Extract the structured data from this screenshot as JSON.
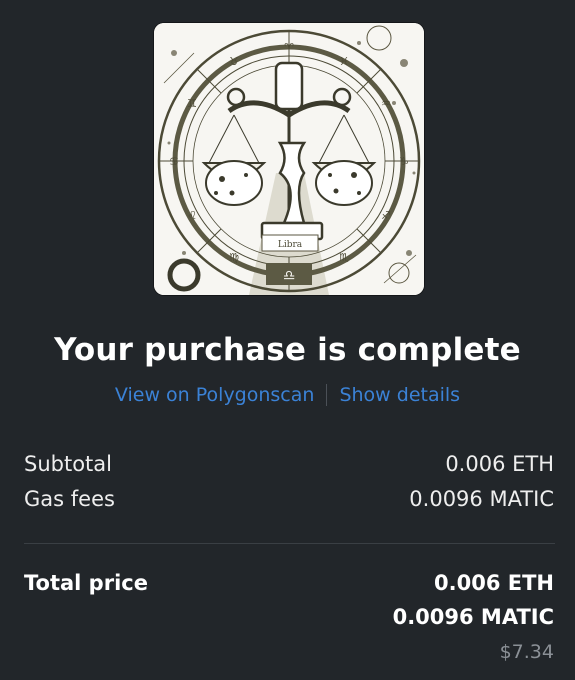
{
  "nft": {
    "image_label": "Libra"
  },
  "heading": "Your purchase is complete",
  "links": {
    "explorer": "View on Polygonscan",
    "details": "Show details"
  },
  "summary": {
    "subtotal_label": "Subtotal",
    "subtotal_value": "0.006 ETH",
    "gas_label": "Gas fees",
    "gas_value": "0.0096 MATIC"
  },
  "total": {
    "label": "Total price",
    "eth": "0.006 ETH",
    "matic": "0.0096 MATIC",
    "usd": "$7.34"
  },
  "colors": {
    "background": "#22262a",
    "link": "#3b82d6",
    "muted": "#8b9096",
    "artwork_ink": "#5a5640"
  }
}
